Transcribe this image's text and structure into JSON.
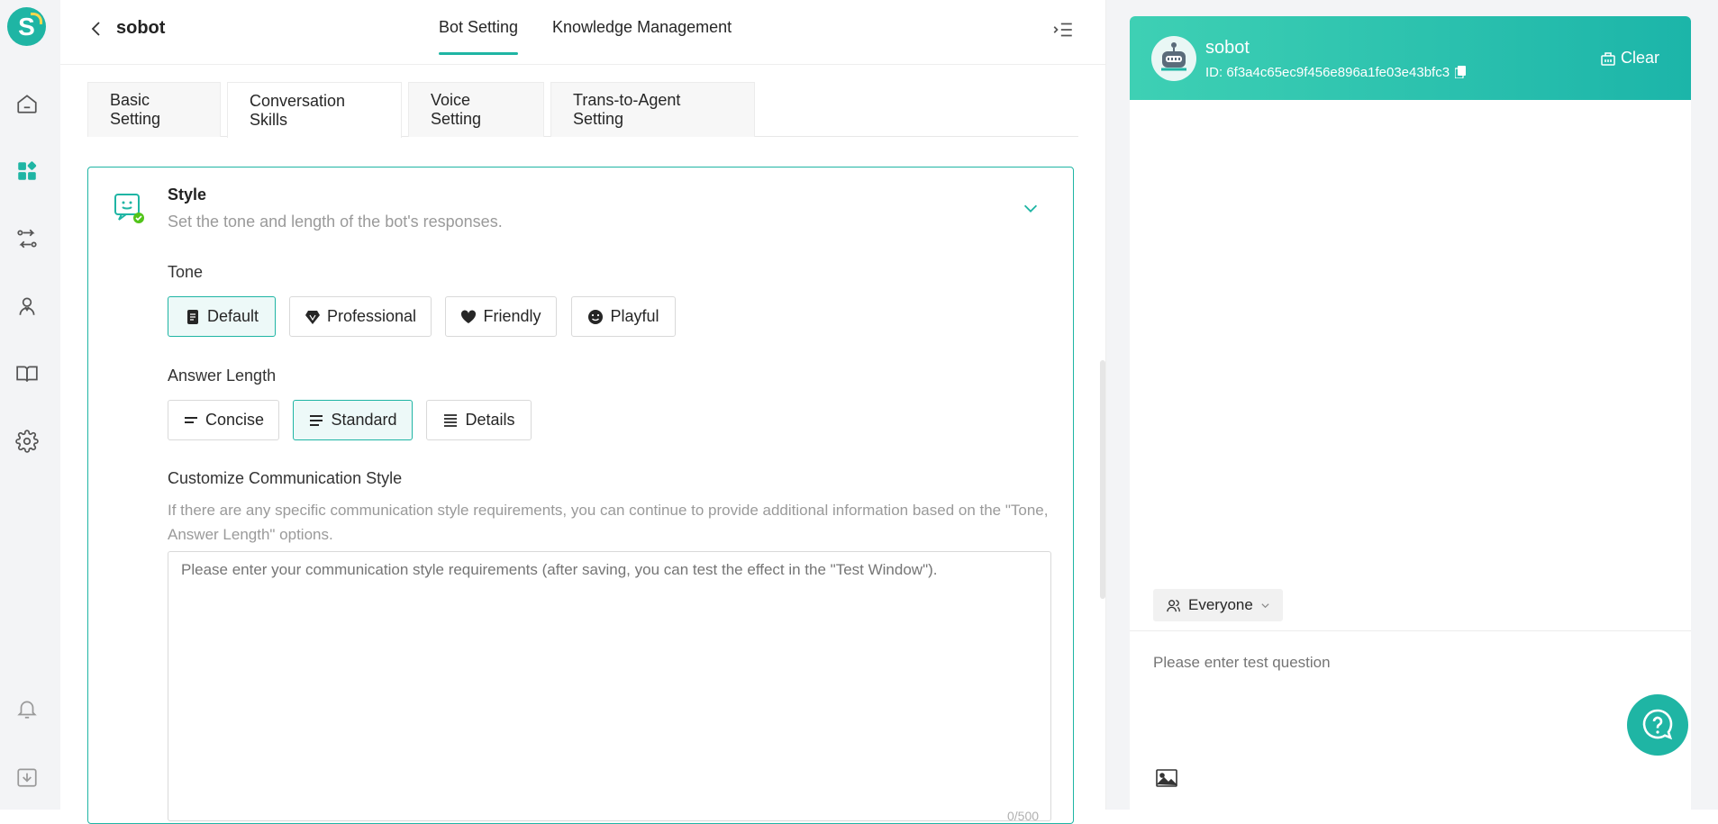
{
  "app": {
    "logo_letter": "S",
    "accent": "#1fb5a4"
  },
  "rail": {
    "icons": [
      "home-icon",
      "apps-icon",
      "flow-icon",
      "agent-icon",
      "book-icon",
      "gear-icon",
      "bell-icon",
      "download-icon"
    ]
  },
  "header": {
    "bot_name": "sobot",
    "tabs": [
      {
        "label": "Bot Setting",
        "active": true
      },
      {
        "label": "Knowledge Management",
        "active": false
      }
    ]
  },
  "subtabs": [
    {
      "label": "Basic Setting",
      "active": false
    },
    {
      "label": "Conversation Skills",
      "active": true
    },
    {
      "label": "Voice Setting",
      "active": false
    },
    {
      "label": "Trans-to-Agent Setting",
      "active": false
    }
  ],
  "style_card": {
    "title": "Style",
    "description": "Set the tone and length of the bot's responses.",
    "tone_label": "Tone",
    "tone_options": [
      {
        "label": "Default",
        "selected": true,
        "icon": "document-icon"
      },
      {
        "label": "Professional",
        "selected": false,
        "icon": "diamond-icon"
      },
      {
        "label": "Friendly",
        "selected": false,
        "icon": "heart-icon"
      },
      {
        "label": "Playful",
        "selected": false,
        "icon": "smile-icon"
      }
    ],
    "length_label": "Answer Length",
    "length_options": [
      {
        "label": "Concise",
        "selected": false,
        "icon": "lines-short-icon"
      },
      {
        "label": "Standard",
        "selected": true,
        "icon": "lines-medium-icon"
      },
      {
        "label": "Details",
        "selected": false,
        "icon": "lines-long-icon"
      }
    ],
    "custom_label": "Customize Communication Style",
    "custom_hint": "If there are any specific communication style requirements, you can continue to provide additional information based on the \"Tone, Answer Length\" options.",
    "custom_placeholder": "Please enter your communication style requirements (after saving, you can test the effect in the \"Test Window\").",
    "counter": "0/500"
  },
  "test_panel": {
    "bot_name": "sobot",
    "bot_id": "ID: 6f3a4c65ec9f456e896a1fe03e43bfc3",
    "clear_label": "Clear",
    "audience": "Everyone",
    "question_placeholder": "Please enter test question"
  }
}
